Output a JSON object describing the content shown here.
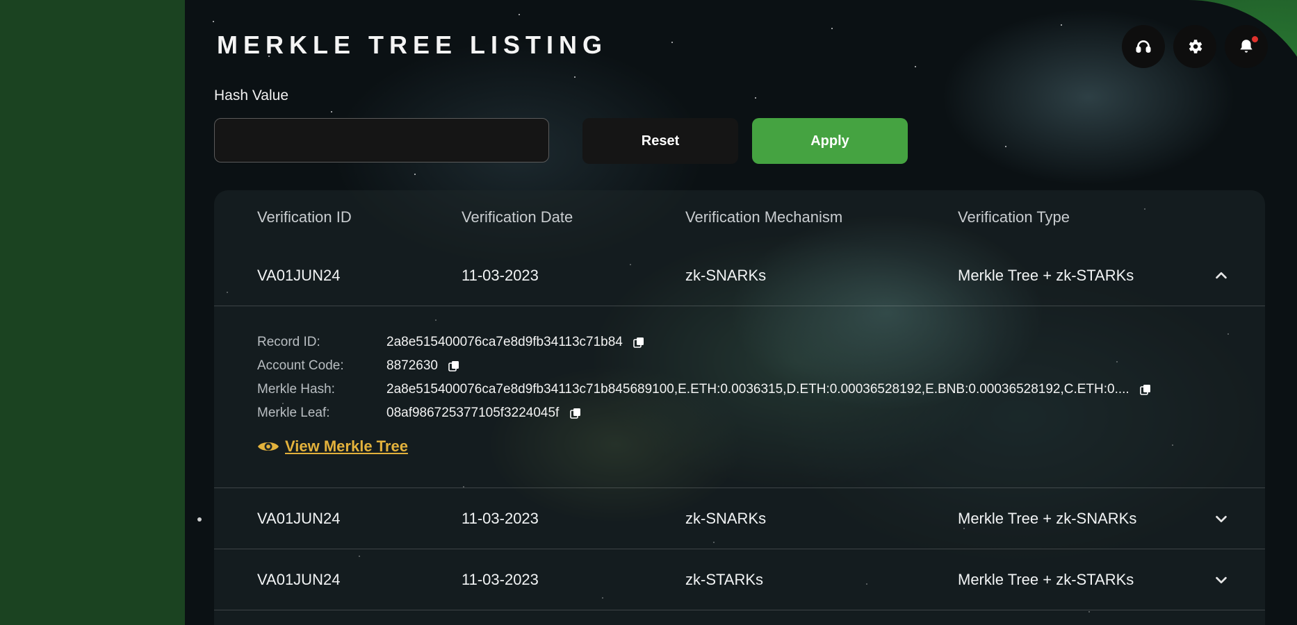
{
  "header": {
    "title": "MERKLE TREE LISTING",
    "actions": [
      {
        "name": "support",
        "icon": "headset-icon"
      },
      {
        "name": "settings",
        "icon": "gear-icon"
      },
      {
        "name": "notifications",
        "icon": "bell-icon",
        "has_notification": true
      }
    ]
  },
  "filter": {
    "label": "Hash Value",
    "value": "",
    "reset_label": "Reset",
    "apply_label": "Apply"
  },
  "table": {
    "columns": [
      "Verification ID",
      "Verification Date",
      "Verification Mechanism",
      "Verification Type"
    ],
    "rows": [
      {
        "id": "VA01JUN24",
        "date": "11-03-2023",
        "mechanism": "zk-SNARKs",
        "type": "Merkle Tree + zk-STARKs",
        "expanded": true
      },
      {
        "id": "VA01JUN24",
        "date": "11-03-2023",
        "mechanism": "zk-SNARKs",
        "type": "Merkle Tree + zk-SNARKs",
        "expanded": false
      },
      {
        "id": "VA01JUN24",
        "date": "11-03-2023",
        "mechanism": "zk-STARKs",
        "type": "Merkle Tree + zk-STARKs",
        "expanded": false
      }
    ],
    "details": {
      "record_id_label": "Record ID:",
      "record_id": "2a8e515400076ca7e8d9fb34113c71b84",
      "account_code_label": "Account Code:",
      "account_code": "8872630",
      "merkle_hash_label": "Merkle Hash:",
      "merkle_hash": "2a8e515400076ca7e8d9fb34113c71b845689100,E.ETH:0.0036315,D.ETH:0.00036528192,E.BNB:0.00036528192,C.ETH:0....",
      "merkle_leaf_label": "Merkle Leaf:",
      "merkle_leaf": "08af986725377105f3224045f",
      "view_link": "View Merkle Tree"
    }
  },
  "colors": {
    "accent_green": "#45a341",
    "link_gold": "#e3b23c",
    "sidebar_green": "#1b4321"
  }
}
